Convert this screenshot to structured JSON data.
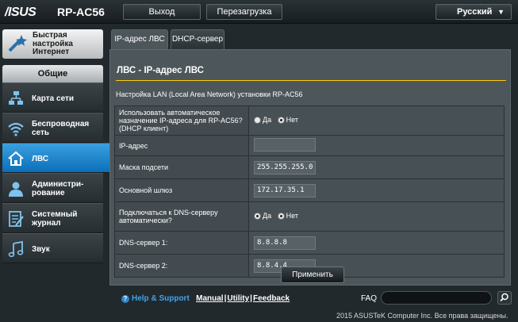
{
  "header": {
    "brand": "/ISUS",
    "model": "RP-AC56",
    "logout_label": "Выход",
    "reboot_label": "Перезагрузка",
    "language": "Русский"
  },
  "sidebar": {
    "quick_setup_label": "Быстрая настройка Интернет",
    "section_title": "Общие",
    "items": [
      {
        "label": "Карта сети",
        "icon": "network-map-icon"
      },
      {
        "label": "Беспроводная сеть",
        "icon": "wifi-icon"
      },
      {
        "label": "ЛВС",
        "icon": "home-icon",
        "active": true
      },
      {
        "label": "Администри-рование",
        "icon": "admin-user-icon"
      },
      {
        "label": "Системный журнал",
        "icon": "log-icon"
      },
      {
        "label": "Звук",
        "icon": "music-note-icon"
      }
    ]
  },
  "tabs": [
    {
      "label": "IP-адрес ЛВС",
      "active": true
    },
    {
      "label": "DHCP-сервер",
      "active": false
    }
  ],
  "main": {
    "title": "ЛВС - IP-адрес ЛВС",
    "description": "Настройка LAN (Local Area Network) установки RP-AC56",
    "rows": {
      "auto_ip_label": "Использовать автоматическое назначение IP-адреса для RP-AC56? (DHCP клиент)",
      "auto_ip_yes": "Да",
      "auto_ip_no": "Нет",
      "ip_label": "IP-адрес",
      "ip_value": "",
      "mask_label": "Маска подсети",
      "mask_value": "255.255.255.0",
      "gateway_label": "Основной шлюз",
      "gateway_value": "172.17.35.1",
      "dns_auto_label": "Подключаться к DNS-серверу автоматически?",
      "dns_auto_yes": "Да",
      "dns_auto_no": "Нет",
      "dns1_label": "DNS-сервер 1:",
      "dns1_value": "8.8.8.8",
      "dns2_label": "DNS-сервер 2:",
      "dns2_value": "8.8.4.4"
    },
    "apply_label": "Применить"
  },
  "footer": {
    "help_label": "Help & Support",
    "manual_label": "Manual",
    "utility_label": "Utility",
    "feedback_label": "Feedback",
    "faq_label": "FAQ",
    "copyright": "2015 ASUSTeK Computer Inc. Все права защищены."
  },
  "colors": {
    "accent": "#0b77c4",
    "title_underline": "#ffcc00",
    "help_link": "#3ea4ea"
  }
}
